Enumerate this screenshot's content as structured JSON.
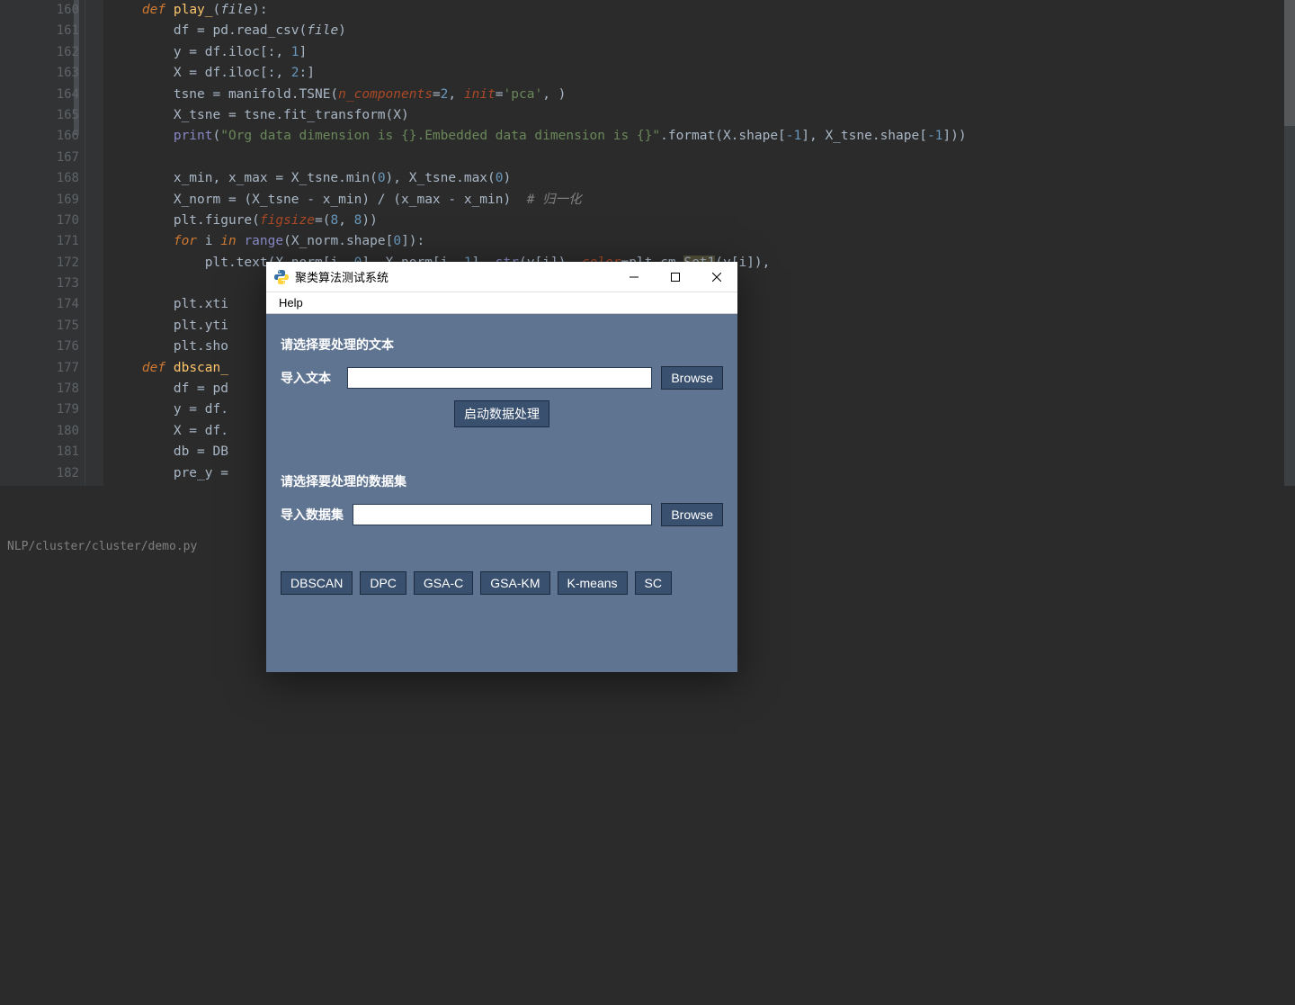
{
  "editor": {
    "lines": [
      {
        "n": 160,
        "tokens": [
          {
            "t": "    ",
            "c": ""
          },
          {
            "t": "def",
            "c": "kw"
          },
          {
            "t": " ",
            "c": ""
          },
          {
            "t": "play_",
            "c": "fn"
          },
          {
            "t": "(",
            "c": "op"
          },
          {
            "t": "file",
            "c": "param"
          },
          {
            "t": "):",
            "c": "op"
          }
        ]
      },
      {
        "n": 161,
        "tokens": [
          {
            "t": "        df = pd.read_csv(",
            "c": ""
          },
          {
            "t": "file",
            "c": "param"
          },
          {
            "t": ")",
            "c": ""
          }
        ]
      },
      {
        "n": 162,
        "tokens": [
          {
            "t": "        y = df.iloc[:, ",
            "c": ""
          },
          {
            "t": "1",
            "c": "num"
          },
          {
            "t": "]",
            "c": ""
          }
        ]
      },
      {
        "n": 163,
        "tokens": [
          {
            "t": "        X = df.iloc[:, ",
            "c": ""
          },
          {
            "t": "2",
            "c": "num"
          },
          {
            "t": ":]",
            "c": ""
          }
        ]
      },
      {
        "n": 164,
        "tokens": [
          {
            "t": "        tsne = manifold.TSNE(",
            "c": ""
          },
          {
            "t": "n_components",
            "c": "kwarg"
          },
          {
            "t": "=",
            "c": ""
          },
          {
            "t": "2",
            "c": "num"
          },
          {
            "t": ", ",
            "c": ""
          },
          {
            "t": "init",
            "c": "kwarg"
          },
          {
            "t": "=",
            "c": ""
          },
          {
            "t": "'pca'",
            "c": "str"
          },
          {
            "t": ", )",
            "c": ""
          }
        ]
      },
      {
        "n": 165,
        "tokens": [
          {
            "t": "        X_tsne = tsne.fit_transform(X)",
            "c": ""
          }
        ]
      },
      {
        "n": 166,
        "tokens": [
          {
            "t": "        ",
            "c": ""
          },
          {
            "t": "print",
            "c": "builtin"
          },
          {
            "t": "(",
            "c": ""
          },
          {
            "t": "\"Org data dimension is {}.Embedded data dimension is {}\"",
            "c": "str"
          },
          {
            "t": ".format(X.shape[",
            "c": ""
          },
          {
            "t": "-1",
            "c": "num"
          },
          {
            "t": "], X_tsne.shape[",
            "c": ""
          },
          {
            "t": "-1",
            "c": "num"
          },
          {
            "t": "]))",
            "c": ""
          }
        ]
      },
      {
        "n": 167,
        "tokens": [
          {
            "t": "",
            "c": ""
          }
        ]
      },
      {
        "n": 168,
        "tokens": [
          {
            "t": "        x_min, x_max = X_tsne.min(",
            "c": ""
          },
          {
            "t": "0",
            "c": "num"
          },
          {
            "t": "), X_tsne.max(",
            "c": ""
          },
          {
            "t": "0",
            "c": "num"
          },
          {
            "t": ")",
            "c": ""
          }
        ]
      },
      {
        "n": 169,
        "tokens": [
          {
            "t": "        X_norm = (X_tsne - x_min) / (x_max - x_min)  ",
            "c": ""
          },
          {
            "t": "# 归一化",
            "c": "comment"
          }
        ]
      },
      {
        "n": 170,
        "tokens": [
          {
            "t": "        plt.figure(",
            "c": ""
          },
          {
            "t": "figsize",
            "c": "kwarg"
          },
          {
            "t": "=(",
            "c": ""
          },
          {
            "t": "8",
            "c": "num"
          },
          {
            "t": ", ",
            "c": ""
          },
          {
            "t": "8",
            "c": "num"
          },
          {
            "t": "))",
            "c": ""
          }
        ]
      },
      {
        "n": 171,
        "tokens": [
          {
            "t": "        ",
            "c": ""
          },
          {
            "t": "for",
            "c": "kw"
          },
          {
            "t": " i ",
            "c": ""
          },
          {
            "t": "in",
            "c": "kw"
          },
          {
            "t": " ",
            "c": ""
          },
          {
            "t": "range",
            "c": "builtin"
          },
          {
            "t": "(X_norm.shape[",
            "c": ""
          },
          {
            "t": "0",
            "c": "num"
          },
          {
            "t": "]):",
            "c": ""
          }
        ]
      },
      {
        "n": 172,
        "tokens": [
          {
            "t": "            plt.text(X_norm[i, ",
            "c": ""
          },
          {
            "t": "0",
            "c": "num"
          },
          {
            "t": "], X_norm[i, ",
            "c": ""
          },
          {
            "t": "1",
            "c": "num"
          },
          {
            "t": "], ",
            "c": ""
          },
          {
            "t": "str",
            "c": "builtin"
          },
          {
            "t": "(y[i]), ",
            "c": ""
          },
          {
            "t": "color",
            "c": "kwarg"
          },
          {
            "t": "=plt.cm.",
            "c": ""
          },
          {
            "t": "Set1",
            "c": "highlight-warn"
          },
          {
            "t": "(y[i]),",
            "c": ""
          }
        ]
      },
      {
        "n": 173,
        "tokens": [
          {
            "t": "                     ",
            "c": ""
          }
        ]
      },
      {
        "n": 174,
        "tokens": [
          {
            "t": "        plt.xti",
            "c": ""
          }
        ]
      },
      {
        "n": 175,
        "tokens": [
          {
            "t": "        plt.yti",
            "c": ""
          }
        ]
      },
      {
        "n": 176,
        "tokens": [
          {
            "t": "        plt.sho",
            "c": ""
          }
        ]
      },
      {
        "n": 177,
        "tokens": [
          {
            "t": "    ",
            "c": ""
          },
          {
            "t": "def",
            "c": "kw"
          },
          {
            "t": " ",
            "c": ""
          },
          {
            "t": "dbscan_",
            "c": "fn"
          }
        ]
      },
      {
        "n": 178,
        "tokens": [
          {
            "t": "        df = pd",
            "c": ""
          }
        ]
      },
      {
        "n": 179,
        "tokens": [
          {
            "t": "        y = df.",
            "c": ""
          }
        ]
      },
      {
        "n": 180,
        "tokens": [
          {
            "t": "        X = df.",
            "c": ""
          }
        ]
      },
      {
        "n": 181,
        "tokens": [
          {
            "t": "        db = DB",
            "c": ""
          }
        ]
      },
      {
        "n": 182,
        "tokens": [
          {
            "t": "        pre_y =",
            "c": ""
          }
        ]
      }
    ]
  },
  "status": {
    "path": "NLP/cluster/cluster/demo.py"
  },
  "dialog": {
    "title": "聚类算法测试系统",
    "menu": {
      "help": "Help"
    },
    "section1_title": "请选择要处理的文本",
    "section1_label": "导入文本",
    "section1_browse": "Browse",
    "process_btn": "启动数据处理",
    "section2_title": "请选择要处理的数据集",
    "section2_label": "导入数据集",
    "section2_browse": "Browse",
    "algos": [
      "DBSCAN",
      "DPC",
      "GSA-C",
      "GSA-KM",
      "K-means",
      "SC"
    ]
  }
}
